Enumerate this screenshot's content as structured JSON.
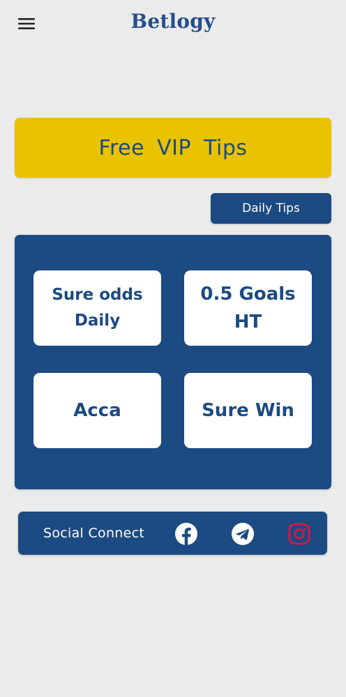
{
  "app": {
    "title": "Betlogy",
    "accent_color": "#1c4a82",
    "banner_color": "#e9c200",
    "background_color": "#ebebeb"
  },
  "header": {
    "menu_icon": "hamburger-menu-icon"
  },
  "banner": {
    "label": "Free VIP Tips"
  },
  "daily_tips_button": {
    "label": "Daily Tips"
  },
  "tips": [
    {
      "label": "Sure odds Daily"
    },
    {
      "label": "0.5 Goals HT"
    },
    {
      "label": "Acca"
    },
    {
      "label": "Sure Win"
    }
  ],
  "social": {
    "label": "Social Connect",
    "icons": [
      "facebook-icon",
      "telegram-icon",
      "instagram-icon"
    ],
    "instagram_color": "#d6164a"
  }
}
